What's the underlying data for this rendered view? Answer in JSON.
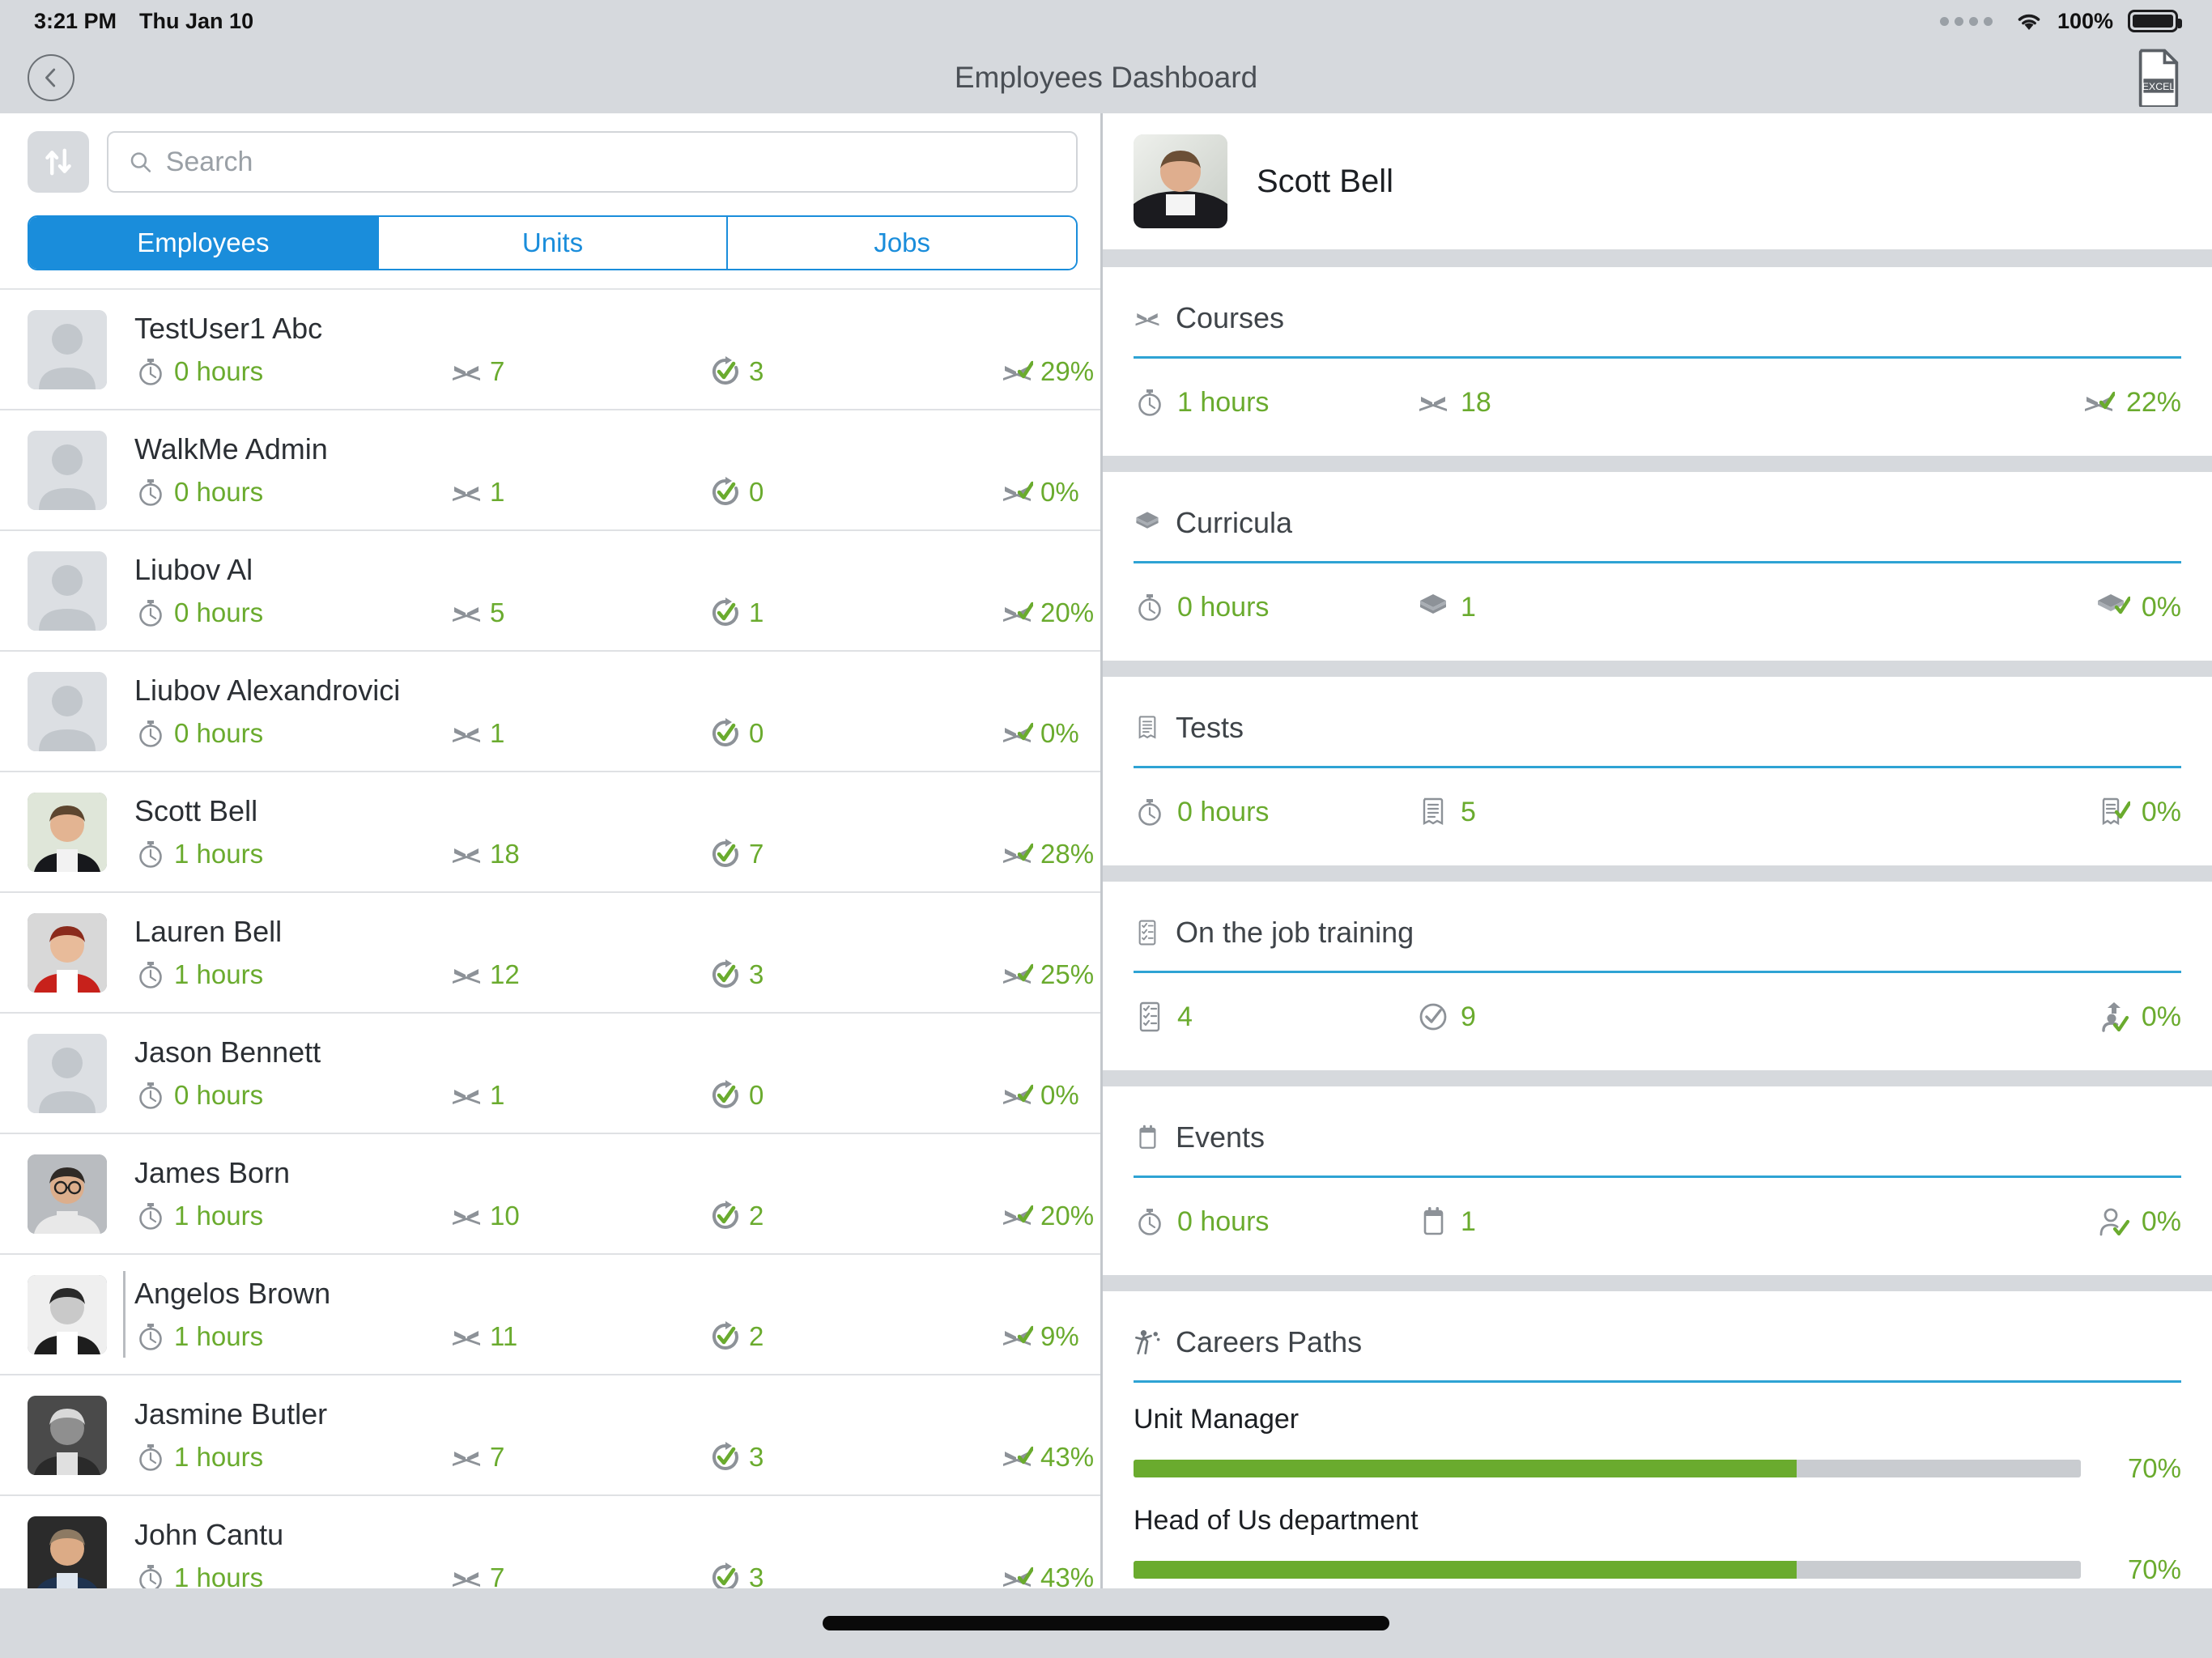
{
  "status_bar": {
    "time": "3:21 PM",
    "date": "Thu Jan 10",
    "battery_percent": "100%",
    "wifi_icon": "wifi-icon",
    "signal_icon": "signal-dots-icon",
    "battery_icon": "battery-icon"
  },
  "header": {
    "back_icon": "back-chevron-icon",
    "title": "Employees Dashboard",
    "export_icon": "excel-export-icon",
    "export_label": "EXCEL"
  },
  "left_panel": {
    "sort_icon": "sort-arrows-icon",
    "search": {
      "icon": "search-icon",
      "placeholder": "Search",
      "value": ""
    },
    "tabs": [
      {
        "label": "Employees",
        "active": true
      },
      {
        "label": "Units",
        "active": false
      },
      {
        "label": "Jobs",
        "active": false
      }
    ],
    "column_icons": {
      "hours": "stopwatch-icon",
      "courses": "open-book-icon",
      "completed": "refresh-check-icon",
      "percent": "book-check-icon"
    },
    "employees": [
      {
        "name": "TestUser1 Abc",
        "hours": "0 hours",
        "courses": "7",
        "completed": "3",
        "percent": "29%",
        "avatar": "placeholder",
        "selected": false
      },
      {
        "name": "WalkMe Admin",
        "hours": "0 hours",
        "courses": "1",
        "completed": "0",
        "percent": "0%",
        "avatar": "placeholder",
        "selected": false
      },
      {
        "name": "Liubov Al",
        "hours": "0 hours",
        "courses": "5",
        "completed": "1",
        "percent": "20%",
        "avatar": "placeholder",
        "selected": false
      },
      {
        "name": "Liubov Alexandrovici",
        "hours": "0 hours",
        "courses": "1",
        "completed": "0",
        "percent": "0%",
        "avatar": "placeholder",
        "selected": false
      },
      {
        "name": "Scott Bell",
        "hours": "1 hours",
        "courses": "18",
        "completed": "7",
        "percent": "28%",
        "avatar": "photo-male-1",
        "selected": false
      },
      {
        "name": "Lauren Bell",
        "hours": "1 hours",
        "courses": "12",
        "completed": "3",
        "percent": "25%",
        "avatar": "photo-female-red",
        "selected": false
      },
      {
        "name": "Jason Bennett",
        "hours": "0 hours",
        "courses": "1",
        "completed": "0",
        "percent": "0%",
        "avatar": "placeholder",
        "selected": false
      },
      {
        "name": "James Born",
        "hours": "1 hours",
        "courses": "10",
        "completed": "2",
        "percent": "20%",
        "avatar": "photo-male-glasses",
        "selected": false
      },
      {
        "name": "Angelos Brown",
        "hours": "1 hours",
        "courses": "11",
        "completed": "2",
        "percent": "9%",
        "avatar": "photo-female-bw",
        "selected": true
      },
      {
        "name": "Jasmine Butler",
        "hours": "1 hours",
        "courses": "7",
        "completed": "3",
        "percent": "43%",
        "avatar": "photo-female-bw2",
        "selected": false
      },
      {
        "name": "John Cantu",
        "hours": "1 hours",
        "courses": "7",
        "completed": "3",
        "percent": "43%",
        "avatar": "photo-male-suit",
        "selected": false
      }
    ]
  },
  "right_panel": {
    "profile": {
      "name": "Scott Bell",
      "avatar": "photo-male-1"
    },
    "cards": [
      {
        "title": "Courses",
        "icon": "open-book-icon",
        "stats": [
          {
            "icon": "stopwatch-icon",
            "value": "1 hours"
          },
          {
            "icon": "open-book-icon",
            "value": "18"
          },
          {
            "icon": "book-check-icon",
            "value": "22%"
          }
        ]
      },
      {
        "title": "Curricula",
        "icon": "books-stack-icon",
        "stats": [
          {
            "icon": "stopwatch-icon",
            "value": "0 hours"
          },
          {
            "icon": "books-stack-icon",
            "value": "1"
          },
          {
            "icon": "books-check-icon",
            "value": "0%"
          }
        ]
      },
      {
        "title": "Tests",
        "icon": "test-paper-icon",
        "stats": [
          {
            "icon": "stopwatch-icon",
            "value": "0 hours"
          },
          {
            "icon": "test-paper-icon",
            "value": "5"
          },
          {
            "icon": "test-check-icon",
            "value": "0%"
          }
        ]
      },
      {
        "title": "On the job training",
        "icon": "checklist-icon",
        "stats": [
          {
            "icon": "checklist-icon",
            "value": "4"
          },
          {
            "icon": "circle-check-icon",
            "value": "9"
          },
          {
            "icon": "person-check-icon",
            "value": "0%"
          }
        ]
      },
      {
        "title": "Events",
        "icon": "calendar-icon",
        "stats": [
          {
            "icon": "stopwatch-icon",
            "value": "0 hours"
          },
          {
            "icon": "calendar-icon",
            "value": "1"
          },
          {
            "icon": "person-check2-icon",
            "value": "0%"
          }
        ]
      }
    ],
    "careers_paths": {
      "title": "Careers Paths",
      "icon": "career-path-icon",
      "items": [
        {
          "label": "Unit Manager",
          "percent": "70%",
          "value": 70
        },
        {
          "label": "Head of Us department",
          "percent": "70%",
          "value": 70
        }
      ]
    }
  },
  "colors": {
    "accent_blue": "#1a8ddb",
    "divider_blue": "#2ea3d4",
    "green": "#6aab2e",
    "chrome_gray": "#d6d9dd"
  }
}
